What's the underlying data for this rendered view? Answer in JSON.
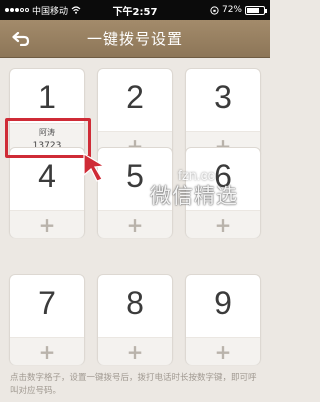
{
  "status_bar": {
    "carrier": "中国移动",
    "time": "下午2:57",
    "battery": "72%",
    "battery_level": 0.72
  },
  "nav": {
    "title": "一键拨号设置"
  },
  "cards": [
    {
      "number": "1",
      "contact_name": "阿涛",
      "contact_phone": "13723"
    },
    {
      "number": "2",
      "action": "+"
    },
    {
      "number": "3",
      "action": "+"
    },
    {
      "number": "4",
      "action": "+"
    },
    {
      "number": "5",
      "action": "+"
    },
    {
      "number": "6",
      "action": "+"
    },
    {
      "number": "7",
      "action": "+"
    },
    {
      "number": "8",
      "action": "+"
    },
    {
      "number": "9",
      "action": "+"
    }
  ],
  "watermark": {
    "url": "fzn.cc",
    "text": "微信精选"
  },
  "footer": {
    "instructions": "点击数字格子，设置一键拨号后，拨打电话时长按数字键，即可呼叫对应号码。"
  },
  "colors": {
    "nav_bg": "#9a8363",
    "highlight": "#cf2b36",
    "background": "#ece8e3"
  }
}
